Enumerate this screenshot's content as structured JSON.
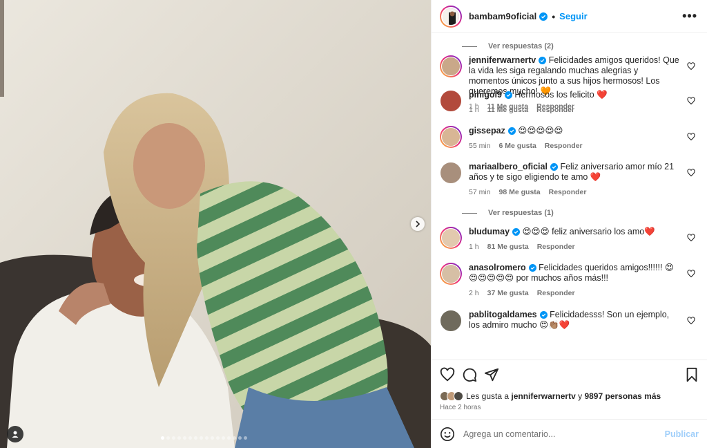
{
  "post": {
    "username": "bambam9oficial",
    "separator": "•",
    "follow_label": "Seguir",
    "more_label": "•••",
    "next_icon": "chevron-right-icon",
    "tag_icon": "user-tag-icon",
    "carousel_count": 16,
    "carousel_active": 0
  },
  "comments": [
    {
      "type": "replies",
      "label": "Ver respuestas (2)"
    },
    {
      "type": "comment",
      "user": "jenniferwarnertv",
      "verified": true,
      "text": "Felicidades amigos queridos! Que la vida les siga regalando muchas alegrias y momentos únicos junto a sus hijos hermosos! Los queremos mucho! 🧡",
      "time": "1 h",
      "likes": "11 Me gusta",
      "reply": "Responder",
      "ring": true,
      "color": "#c9a889"
    },
    {
      "type": "comment",
      "user": "pinigol9",
      "verified": true,
      "text": "Hermosos los felicito ❤️",
      "time": "1 h",
      "likes": "11 Me gusta",
      "reply": "Responder",
      "ring": false,
      "color": "#b24a3c"
    },
    {
      "type": "comment",
      "user": "gissepaz",
      "verified": true,
      "text": "😍😍😍😍😍",
      "time": "55 min",
      "likes": "6 Me gusta",
      "reply": "Responder",
      "ring": true,
      "color": "#d8b695"
    },
    {
      "type": "comment",
      "user": "mariaalbero_oficial",
      "verified": true,
      "text": "Feliz aniversario amor mío 21 años y te sigo eligiendo te amo ❤️",
      "time": "57 min",
      "likes": "98 Me gusta",
      "reply": "Responder",
      "ring": false,
      "color": "#a88f7c"
    },
    {
      "type": "replies",
      "label": "Ver respuestas (1)"
    },
    {
      "type": "comment",
      "user": "bludumay",
      "verified": true,
      "text": "😍😍😍 feliz aniversario los amo❤️",
      "time": "1 h",
      "likes": "81 Me gusta",
      "reply": "Responder",
      "ring": true,
      "color": "#e2c9ae"
    },
    {
      "type": "comment",
      "user": "anasolromero",
      "verified": true,
      "text": "Felicidades queridos amigos!!!!!! 😍😍😍😍😍😍 por muchos años más!!!",
      "time": "2 h",
      "likes": "37 Me gusta",
      "reply": "Responder",
      "ring": true,
      "color": "#d6bfa5"
    },
    {
      "type": "comment",
      "user": "pablitogaldames",
      "verified": true,
      "text": "Felicidadesss! Son un ejemplo, los admiro mucho 😍👏🏽❤️",
      "time": "",
      "likes": "",
      "reply": "",
      "ring": false,
      "color": "#6f6a5c"
    }
  ],
  "actions": {
    "like_icon": "heart-icon",
    "comment_icon": "comment-icon",
    "share_icon": "send-icon",
    "save_icon": "bookmark-icon"
  },
  "likes": {
    "prefix": "Les gusta a",
    "user": "jenniferwarnertv",
    "conj": "y",
    "count": "9897 personas más"
  },
  "time_ago": "Hace 2 horas",
  "composer": {
    "emoji_icon": "emoji-icon",
    "placeholder": "Agrega un comentario...",
    "post_label": "Publicar"
  },
  "colors": {
    "accent": "#0095f6",
    "muted": "#737373",
    "verified": "#0095f6",
    "heart_red": "#ed4956"
  }
}
